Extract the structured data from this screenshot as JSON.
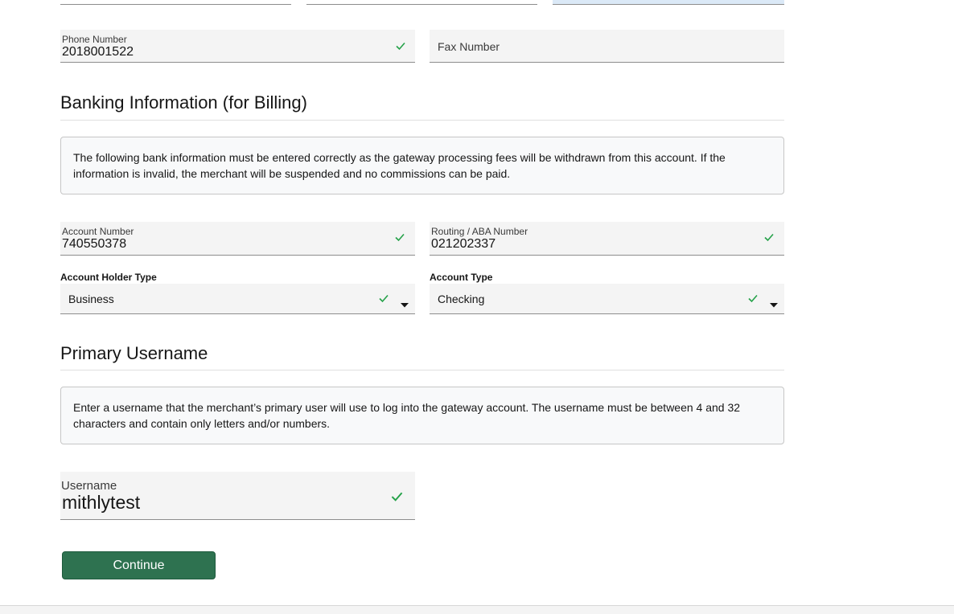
{
  "contact": {
    "phone_label": "Phone Number",
    "phone_value": "2018001522",
    "fax_placeholder": "Fax Number"
  },
  "banking": {
    "title": "Banking Information (for Billing)",
    "notice": "The following bank information must be entered correctly as the gateway processing fees will be withdrawn from this account. If the information is invalid, the merchant will be suspended and no commissions can be paid.",
    "account_number_label": "Account Number",
    "account_number_value": "740550378",
    "routing_label": "Routing / ABA Number",
    "routing_value": "021202337",
    "holder_type_label": "Account Holder Type",
    "holder_type_value": "Business",
    "account_type_label": "Account Type",
    "account_type_value": "Checking"
  },
  "username_section": {
    "title": "Primary Username",
    "notice": "Enter a username that the merchant’s primary user will use to log into the gateway account. The username must be between 4 and 32 characters and contain only letters and/or numbers.",
    "username_label": "Username",
    "username_value": "mithlytest"
  },
  "actions": {
    "continue_label": "Continue"
  },
  "colors": {
    "valid_check": "#24a148",
    "primary_button": "#2e7250",
    "field_bg": "#f4f4f4"
  },
  "icons": {
    "valid": "check-icon",
    "dropdown": "caret-down-icon"
  }
}
